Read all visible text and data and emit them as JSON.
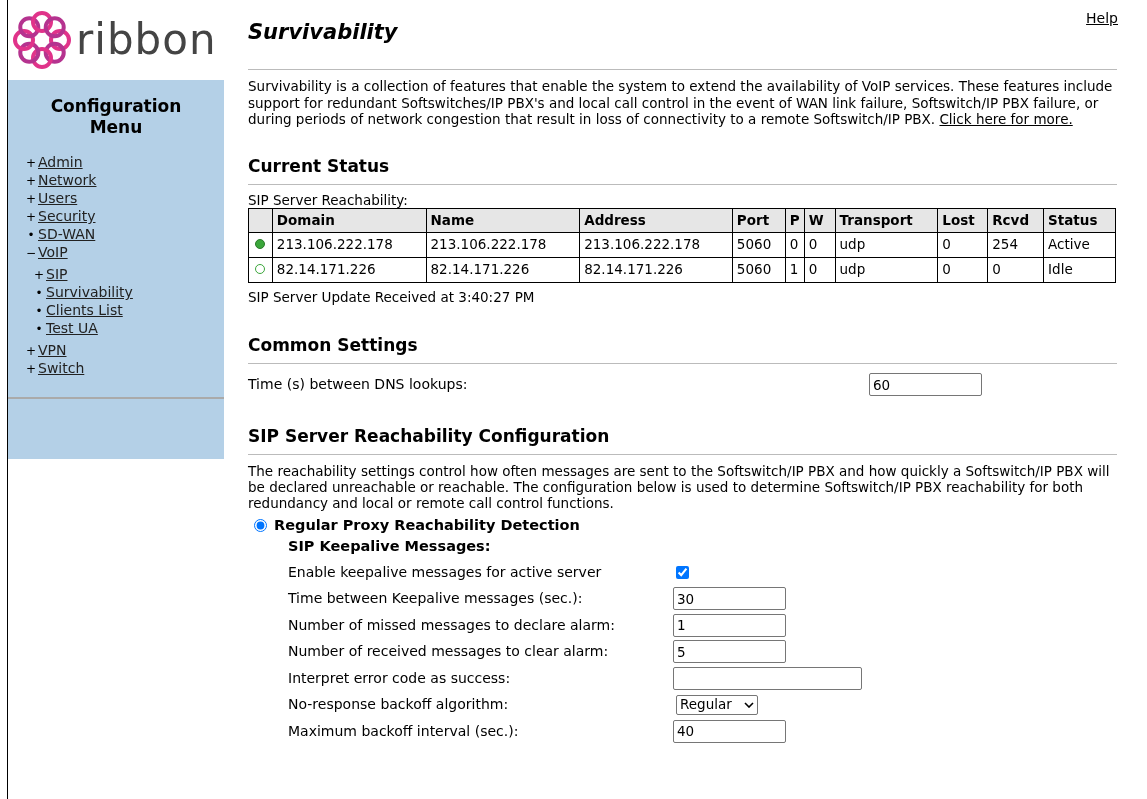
{
  "help_link": "Help",
  "logo_text": "ribbon",
  "sidebar": {
    "title": "Configuration Menu",
    "items": [
      {
        "marker": "+",
        "label": "Admin"
      },
      {
        "marker": "+",
        "label": "Network"
      },
      {
        "marker": "+",
        "label": "Users"
      },
      {
        "marker": "+",
        "label": "Security"
      },
      {
        "marker": "•",
        "label": "SD-WAN"
      },
      {
        "marker": "−",
        "label": "VoIP",
        "children": [
          {
            "marker": "+",
            "label": "SIP"
          },
          {
            "marker": "•",
            "label": "Survivability"
          },
          {
            "marker": "•",
            "label": "Clients List"
          },
          {
            "marker": "•",
            "label": "Test UA"
          }
        ]
      },
      {
        "marker": "+",
        "label": "VPN"
      },
      {
        "marker": "+",
        "label": "Switch"
      }
    ]
  },
  "page_title": "Survivability",
  "description": {
    "text": "Survivability is a collection of features that enable the system to extend the availability of VoIP services. These features include support for redundant Softswitches/IP PBX's and local call control in the event of WAN link failure, Softswitch/IP PBX failure, or during periods of network congestion that result in loss of connectivity to a remote Softswitch/IP PBX.",
    "link": "Click here for more."
  },
  "current_status": {
    "heading": "Current Status",
    "table_caption": "SIP Server Reachability:",
    "columns": [
      "Domain",
      "Name",
      "Address",
      "Port",
      "P",
      "W",
      "Transport",
      "Lost",
      "Rcvd",
      "Status"
    ],
    "rows": [
      {
        "reachable": true,
        "cells": [
          "213.106.222.178",
          "213.106.222.178",
          "213.106.222.178",
          "5060",
          "0",
          "0",
          "udp",
          "0",
          "254",
          "Active"
        ]
      },
      {
        "reachable": false,
        "cells": [
          "82.14.171.226",
          "82.14.171.226",
          "82.14.171.226",
          "5060",
          "1",
          "0",
          "udp",
          "0",
          "0",
          "Idle"
        ]
      }
    ],
    "update_note": "SIP Server Update Received at 3:40:27 PM"
  },
  "common_settings": {
    "heading": "Common Settings",
    "fields": [
      {
        "label": "Time (s) between DNS lookups:",
        "value": "60"
      }
    ]
  },
  "reachability_config": {
    "heading": "SIP Server Reachability Configuration",
    "text": "The reachability settings control how often messages are sent to the Softswitch/IP PBX and how quickly a Softswitch/IP PBX will be declared unreachable or reachable. The configuration below is used to determine Softswitch/IP PBX reachability for both redundancy and local or remote call control functions.",
    "mode": {
      "label": "Regular Proxy Reachability Detection",
      "selected": true
    },
    "subheading": "SIP Keepalive Messages:",
    "fields": [
      {
        "kind": "checkbox",
        "label": "Enable keepalive messages for active server",
        "checked": true
      },
      {
        "kind": "text",
        "label": "Time between Keepalive messages (sec.):",
        "value": "30"
      },
      {
        "kind": "text",
        "label": "Number of missed messages to declare alarm:",
        "value": "1"
      },
      {
        "kind": "text",
        "label": "Number of received messages to clear alarm:",
        "value": "5"
      },
      {
        "kind": "wide_text",
        "label": "Interpret error code as success:"
      },
      {
        "kind": "select",
        "label": "No-response backoff algorithm:",
        "value": "Regular"
      },
      {
        "kind": "text",
        "label": "Maximum backoff interval (sec.):",
        "value": "40"
      }
    ]
  }
}
